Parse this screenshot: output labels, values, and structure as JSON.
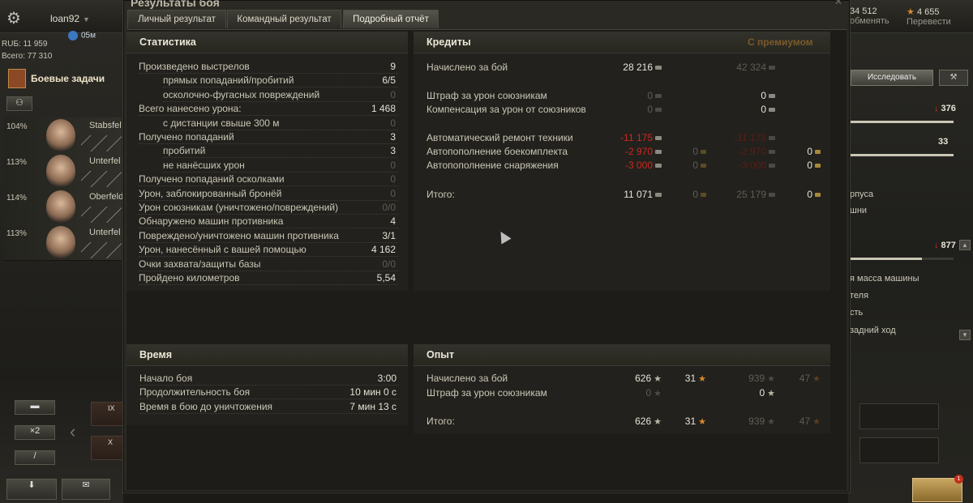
{
  "client": {
    "player_name": "loan92",
    "clock": "05м",
    "rub": "RUБ: 11 959",
    "total": "Всего: 77 310",
    "tasks_label": "Боевые задачи",
    "x2_label": "×2",
    "crew": [
      {
        "pct": "104%",
        "name": "Stabsfel"
      },
      {
        "pct": "113%",
        "name": "Unterfel"
      },
      {
        "pct": "114%",
        "name": "Oberfeld"
      },
      {
        "pct": "113%",
        "name": "Unterfel"
      }
    ],
    "tier_labels": [
      "IX",
      "X"
    ],
    "top_right": [
      {
        "value": "34 512",
        "sub": "обменять"
      },
      {
        "value": "4 655",
        "sub": "Перевести"
      }
    ],
    "research_label": "Исследовать",
    "right_values": {
      "v1": "376",
      "v2": "33",
      "v3": "877"
    },
    "right_fill": 0.7,
    "right_texts": [
      "рпуса",
      "шни",
      "я масса машины",
      "теля",
      "сть",
      "задний ход"
    ],
    "notification_count": "1"
  },
  "window": {
    "title": "Результаты боя",
    "tabs": [
      "Личный результат",
      "Командный результат",
      "Подробный отчёт"
    ],
    "active_tab": 2
  },
  "statistics": {
    "header": "Статистика",
    "rows": [
      {
        "label": "Произведено выстрелов",
        "value": "9",
        "indent": false,
        "zero": false
      },
      {
        "label": "прямых попаданий/пробитий",
        "value": "6/5",
        "indent": true,
        "zero": false
      },
      {
        "label": "осколочно-фугасных повреждений",
        "value": "0",
        "indent": true,
        "zero": true
      },
      {
        "label": "Всего нанесено урона:",
        "value": "1 468",
        "indent": false,
        "zero": false
      },
      {
        "label": "с дистанции свыше 300 м",
        "value": "0",
        "indent": true,
        "zero": true
      },
      {
        "label": "Получено попаданий",
        "value": "3",
        "indent": false,
        "zero": false
      },
      {
        "label": "пробитий",
        "value": "3",
        "indent": true,
        "zero": false
      },
      {
        "label": "не нанёсших урон",
        "value": "0",
        "indent": true,
        "zero": true
      },
      {
        "label": "Получено попаданий осколками",
        "value": "0",
        "indent": false,
        "zero": true
      },
      {
        "label": "Урон, заблокированный бронёй",
        "value": "0",
        "indent": false,
        "zero": true
      },
      {
        "label": "Урон союзникам (уничтожено/повреждений)",
        "value": "0/0",
        "indent": false,
        "zero": true
      },
      {
        "label": "Обнаружено машин противника",
        "value": "4",
        "indent": false,
        "zero": false
      },
      {
        "label": "Повреждено/уничтожено машин противника",
        "value": "3/1",
        "indent": false,
        "zero": false
      },
      {
        "label": "Урон, нанесённый с вашей помощью",
        "value": "4 162",
        "indent": false,
        "zero": false
      },
      {
        "label": "Очки захвата/защиты базы",
        "value": "0/0",
        "indent": false,
        "zero": true
      },
      {
        "label": "Пройдено километров",
        "value": "5,54",
        "indent": false,
        "zero": false
      }
    ]
  },
  "credits": {
    "header": "Кредиты",
    "premium_header": "С премиумом",
    "rows": [
      {
        "label": "Начислено за бой",
        "c": "28 216",
        "cs": "w",
        "g": "",
        "gs": "",
        "pc": "42 324",
        "pcs": "g",
        "pg": "",
        "pgs": ""
      },
      {
        "label": "Штраф за урон союзникам",
        "c": "0",
        "cs": "g",
        "g": "",
        "gs": "",
        "pc": "0",
        "pcs": "w",
        "pg": "",
        "pgs": ""
      },
      {
        "label": "Компенсация за урон от союзников",
        "c": "0",
        "cs": "g",
        "g": "",
        "gs": "",
        "pc": "0",
        "pcs": "w",
        "pg": "",
        "pgs": ""
      },
      {
        "label": "Автоматический ремонт техники",
        "c": "-11 175",
        "cs": "r",
        "g": "",
        "gs": "",
        "pc": "-11 175",
        "pcs": "dr",
        "pg": "",
        "pgs": ""
      },
      {
        "label": "Автопополнение боекомплекта",
        "c": "-2 970",
        "cs": "r",
        "g": "0",
        "gs": "g",
        "pc": "-2 970",
        "pcs": "dr",
        "pg": "0",
        "pgs": "w"
      },
      {
        "label": "Автопополнение снаряжения",
        "c": "-3 000",
        "cs": "r",
        "g": "0",
        "gs": "g",
        "pc": "-3 000",
        "pcs": "dr",
        "pg": "0",
        "pgs": "w"
      },
      {
        "label": "Итого:",
        "c": "11 071",
        "cs": "w",
        "g": "0",
        "gs": "g",
        "pc": "25 179",
        "pcs": "g",
        "pg": "0",
        "pgs": "w"
      }
    ]
  },
  "time": {
    "header": "Время",
    "rows": [
      {
        "label": "Начало боя",
        "value": "3:00"
      },
      {
        "label": "Продолжительность боя",
        "value": "10 мин 0 с"
      },
      {
        "label": "Время в бою до уничтожения",
        "value": "7 мин 13 с"
      }
    ]
  },
  "experience": {
    "header": "Опыт",
    "rows": [
      {
        "label": "Начислено за бой",
        "xp": "626",
        "xps": "w",
        "fxp": "31",
        "fxps": "o",
        "pxp": "939",
        "pxps": "g",
        "pfxp": "47",
        "pfxps": "go"
      },
      {
        "label": "Штраф за урон союзникам",
        "xp": "0",
        "xps": "g",
        "fxp": "",
        "fxps": "",
        "pxp": "0",
        "pxps": "w",
        "pfxp": "",
        "pfxps": ""
      },
      {
        "label": "Итого:",
        "xp": "626",
        "xps": "w",
        "fxp": "31",
        "fxps": "o",
        "pxp": "939",
        "pxps": "g",
        "pfxp": "47",
        "pfxps": "go"
      }
    ]
  }
}
